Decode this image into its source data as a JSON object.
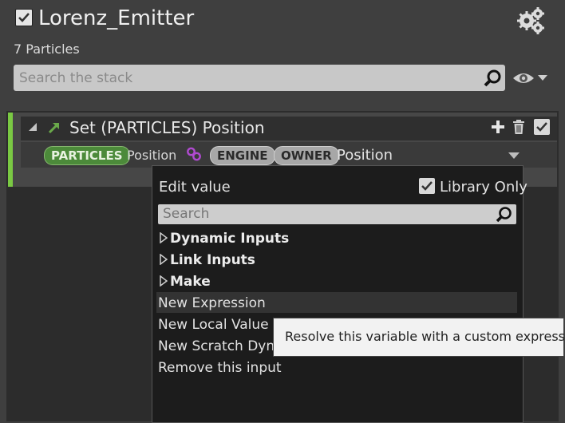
{
  "header": {
    "title": "Lorenz_Emitter",
    "particle_count": "7 Particles",
    "search_placeholder": "Search the stack"
  },
  "module": {
    "title": "Set (PARTICLES) Position",
    "row": {
      "namespace_pill": "PARTICLES",
      "param_label": "Position",
      "engine_pill": "ENGINE",
      "owner_pill": "OWNER",
      "value_label": "Position"
    }
  },
  "menu": {
    "heading": "Edit value",
    "library_only_label": "Library Only",
    "library_only_checked": true,
    "search_placeholder": "Search",
    "categories": [
      "Dynamic Inputs",
      "Link Inputs",
      "Make"
    ],
    "items": [
      "New Expression",
      "New Local Value",
      "New Scratch Dyna",
      "Remove this input"
    ],
    "highlighted_item": "New Expression"
  },
  "tooltip": {
    "text": "Resolve this variable with a custom expression."
  },
  "colors": {
    "accent_green": "#7ac943",
    "link_purple": "#b04ad0"
  }
}
